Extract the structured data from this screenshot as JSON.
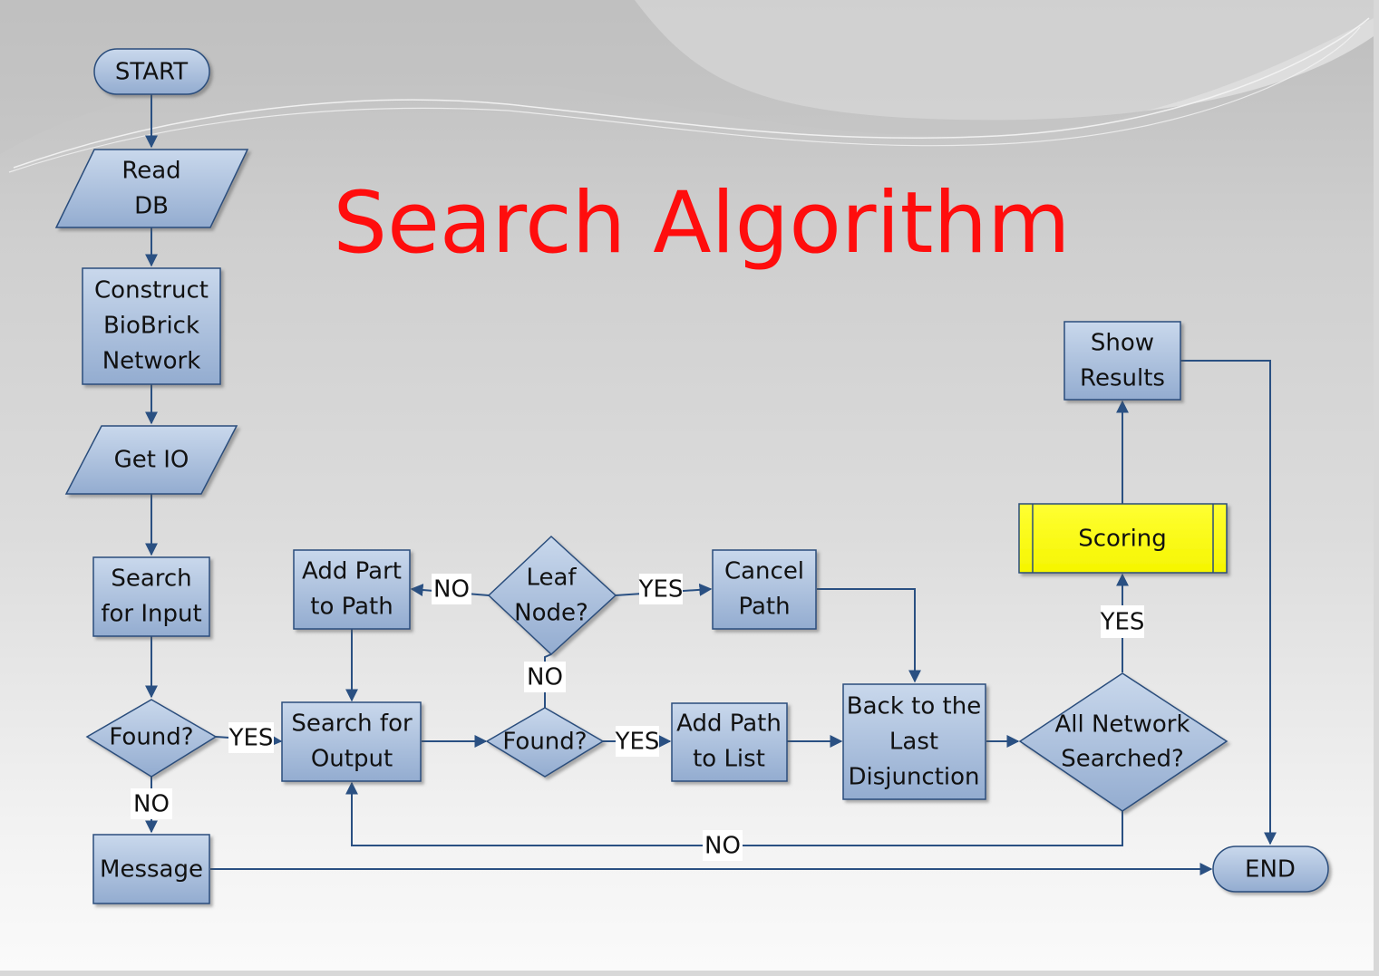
{
  "title": "Search Algorithm",
  "colors": {
    "title": "#ff0d0d",
    "node_fill_top": "#c6d6ea",
    "node_fill_bottom": "#94aed0",
    "node_stroke": "#2a4d7c",
    "highlight_fill": "#ffff00",
    "edge": "#2a5082"
  },
  "nodes": {
    "start": {
      "label": [
        "START"
      ],
      "shape": "terminator"
    },
    "read_db": {
      "label": [
        "Read",
        "DB"
      ],
      "shape": "data"
    },
    "construct": {
      "label": [
        "Construct",
        "BioBrick",
        "Network"
      ],
      "shape": "process"
    },
    "get_io": {
      "label": [
        "Get IO"
      ],
      "shape": "data"
    },
    "search_input": {
      "label": [
        "Search",
        "for Input"
      ],
      "shape": "process"
    },
    "found1": {
      "label": [
        "Found?"
      ],
      "shape": "decision"
    },
    "message": {
      "label": [
        "Message"
      ],
      "shape": "process"
    },
    "search_output": {
      "label": [
        "Search for",
        "Output"
      ],
      "shape": "process"
    },
    "add_part": {
      "label": [
        "Add Part",
        "to Path"
      ],
      "shape": "process"
    },
    "leaf": {
      "label": [
        "Leaf",
        "Node?"
      ],
      "shape": "decision"
    },
    "cancel": {
      "label": [
        "Cancel",
        "Path"
      ],
      "shape": "process"
    },
    "found2": {
      "label": [
        "Found?"
      ],
      "shape": "decision"
    },
    "add_path": {
      "label": [
        "Add Path",
        "to List"
      ],
      "shape": "process"
    },
    "back": {
      "label": [
        "Back to the",
        "Last",
        "Disjunction"
      ],
      "shape": "process"
    },
    "all_searched": {
      "label": [
        "All Network",
        "Searched?"
      ],
      "shape": "decision"
    },
    "scoring": {
      "label": [
        "Scoring"
      ],
      "shape": "predefined-process"
    },
    "show_results": {
      "label": [
        "Show",
        "Results"
      ],
      "shape": "process"
    },
    "end": {
      "label": [
        "END"
      ],
      "shape": "terminator"
    }
  },
  "edges": [
    {
      "from": "start",
      "to": "read_db",
      "label": ""
    },
    {
      "from": "read_db",
      "to": "construct",
      "label": ""
    },
    {
      "from": "construct",
      "to": "get_io",
      "label": ""
    },
    {
      "from": "get_io",
      "to": "search_input",
      "label": ""
    },
    {
      "from": "search_input",
      "to": "found1",
      "label": ""
    },
    {
      "from": "found1",
      "to": "search_output",
      "label": "YES"
    },
    {
      "from": "found1",
      "to": "message",
      "label": "NO"
    },
    {
      "from": "message",
      "to": "end",
      "label": ""
    },
    {
      "from": "search_output",
      "to": "found2",
      "label": ""
    },
    {
      "from": "found2",
      "to": "leaf",
      "label": "NO"
    },
    {
      "from": "leaf",
      "to": "add_part",
      "label": "NO"
    },
    {
      "from": "leaf",
      "to": "cancel",
      "label": "YES"
    },
    {
      "from": "add_part",
      "to": "search_output",
      "label": ""
    },
    {
      "from": "found2",
      "to": "add_path",
      "label": "YES"
    },
    {
      "from": "add_path",
      "to": "back",
      "label": ""
    },
    {
      "from": "cancel",
      "to": "back",
      "label": ""
    },
    {
      "from": "back",
      "to": "all_searched",
      "label": ""
    },
    {
      "from": "all_searched",
      "to": "scoring",
      "label": "YES"
    },
    {
      "from": "all_searched",
      "to": "search_output",
      "label": "NO"
    },
    {
      "from": "scoring",
      "to": "show_results",
      "label": ""
    },
    {
      "from": "show_results",
      "to": "end",
      "label": ""
    }
  ]
}
